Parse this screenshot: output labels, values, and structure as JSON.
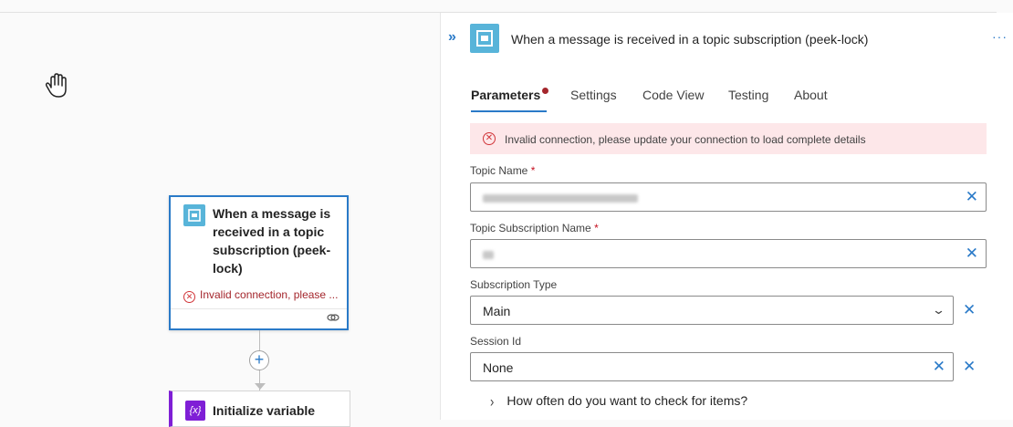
{
  "canvas": {
    "trigger_card": {
      "title": "When a message is received in a topic subscription (peek-lock)",
      "error": "Invalid connection, please ...",
      "icon": "service-bus-icon"
    },
    "add_step_symbol": "+",
    "next_card": {
      "title": "Initialize variable",
      "icon_text": "{x}"
    }
  },
  "panel": {
    "collapse_symbol": "»",
    "title": "When a message is received in a topic subscription (peek-lock)",
    "more_symbol": "···",
    "tabs": [
      {
        "label": "Parameters",
        "active": true,
        "has_error": true
      },
      {
        "label": "Settings"
      },
      {
        "label": "Code View"
      },
      {
        "label": "Testing"
      },
      {
        "label": "About"
      }
    ],
    "alert": {
      "text": "Invalid connection, please update your connection to load complete details"
    },
    "fields": {
      "topic_name": {
        "label": "Topic Name",
        "required": "*"
      },
      "topic_subscription_name": {
        "label": "Topic Subscription Name",
        "required": "*"
      },
      "subscription_type": {
        "label": "Subscription Type",
        "value": "Main"
      },
      "session_id": {
        "label": "Session Id",
        "value": "None"
      }
    },
    "advanced_toggle": "How often do you want to check for items?"
  },
  "colors": {
    "accent": "#2a7ac8",
    "error": "#a4262c",
    "service_bus": "#58b4d9",
    "variable": "#7f1fd6"
  }
}
